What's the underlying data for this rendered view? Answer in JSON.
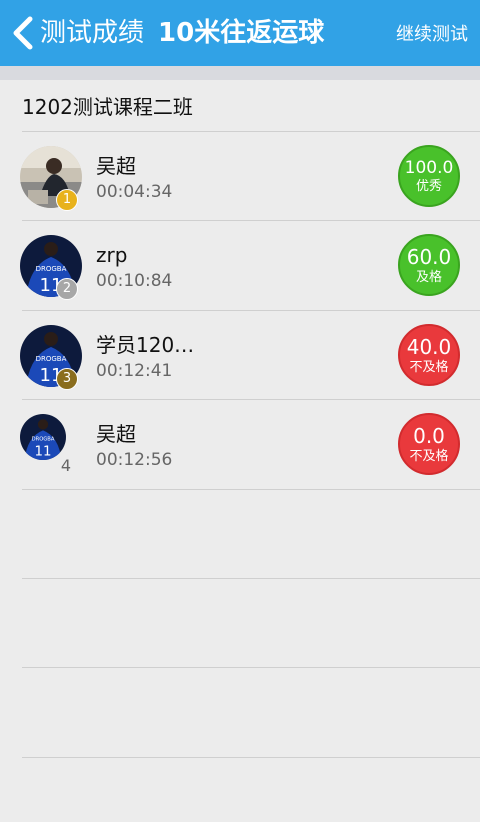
{
  "header": {
    "title": "测试成绩",
    "subtitle": "10米往返运球",
    "action_label": "继续测试",
    "back_icon": "chevron-left-icon",
    "bg_color": "#31a2e6"
  },
  "class_name": "1202测试课程二班",
  "results": [
    {
      "rank": "1",
      "name": "吴超",
      "time": "00:04:34",
      "score": "100.0",
      "grade": "优秀",
      "status": "green"
    },
    {
      "rank": "2",
      "name": "zrp",
      "time": "00:10:84",
      "score": "60.0",
      "grade": "及格",
      "status": "green"
    },
    {
      "rank": "3",
      "name": "学员120…",
      "time": "00:12:41",
      "score": "40.0",
      "grade": "不及格",
      "status": "red"
    },
    {
      "rank": "4",
      "name": "吴超",
      "time": "00:12:56",
      "score": "0.0",
      "grade": "不及格",
      "status": "red"
    }
  ],
  "colors": {
    "pass": "#49c12b",
    "fail": "#e9393c",
    "gold": "#e8b21c",
    "silver": "#a7a7a7",
    "bronze": "#8a6d1e"
  }
}
